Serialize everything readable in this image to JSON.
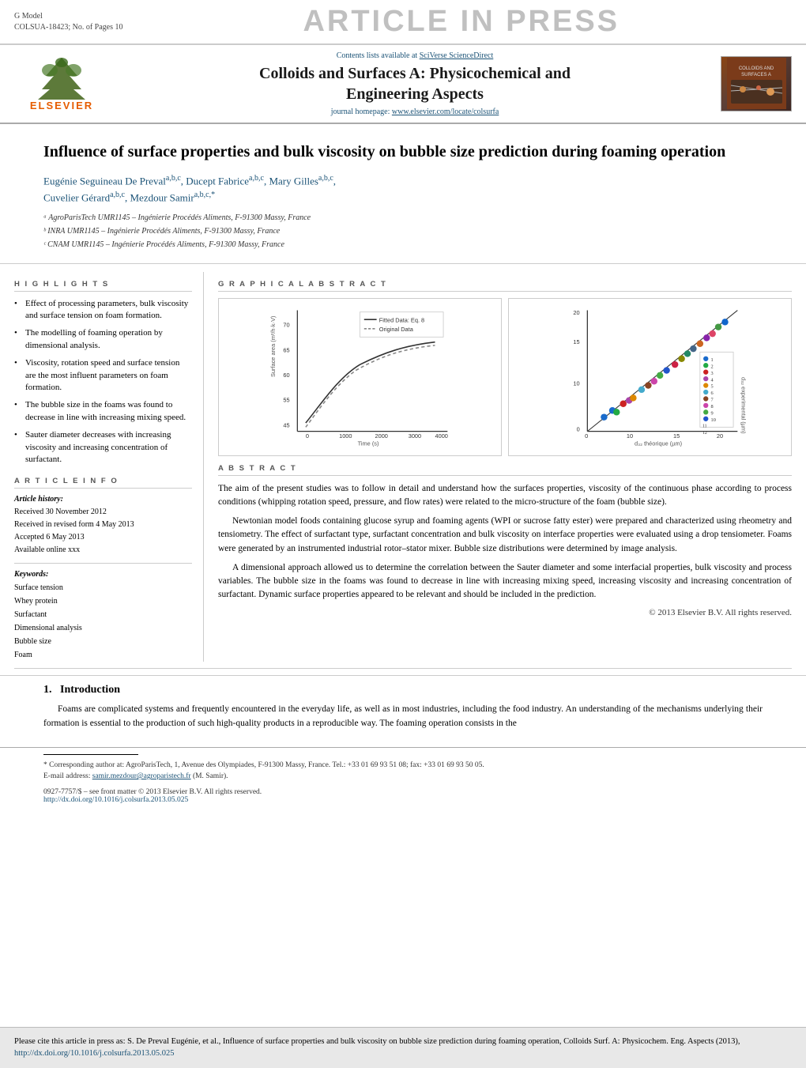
{
  "top_header": {
    "g_model": "G Model",
    "colsua": "COLSUA-18423;   No. of Pages 10",
    "banner": "ARTICLE IN PRESS"
  },
  "journal": {
    "sciverse_text": "Contents lists available at SciVerse ScienceDirect",
    "title_line1": "Colloids and Surfaces A: Physicochemical and",
    "title_line2": "Engineering Aspects",
    "homepage_label": "journal homepage:",
    "homepage_url": "www.elsevier.com/locate/colsurfa",
    "elsevier_label": "ELSEVIER"
  },
  "article": {
    "title": "Influence of surface properties and bulk viscosity on bubble size prediction during foaming operation",
    "authors": "Eugénie Seguineau De Prevalᵃᵇᶜ, Ducept Fabriceᵃᵇᶜ, Mary Gillesᵃᵇᶜ, Cuvelier Gérardᵃᵇᶜ, Mezdour Samirᵃᵇᶜ*",
    "affil_a": "ᵃ AgroParisTech UMR1145 – Ingénierie Procédés Aliments, F-91300 Massy, France",
    "affil_b": "ᵇ INRA UMR1145 – Ingénierie Procédés Aliments, F-91300 Massy, France",
    "affil_c": "ᶜ CNAM UMR1145 – Ingénierie Procédés Aliments, F-91300 Massy, France"
  },
  "highlights": {
    "header": "H I G H L I G H T S",
    "items": [
      "Effect of processing parameters, bulk viscosity and surface tension on foam formation.",
      "The modelling of foaming operation by dimensional analysis.",
      "Viscosity, rotation speed and surface tension are the most influent parameters on foam formation.",
      "The bubble size in the foams was found to decrease in line with increasing mixing speed.",
      "Sauter diameter decreases with increasing viscosity and increasing concentration of surfactant."
    ]
  },
  "article_info": {
    "header": "A R T I C L E   I N F O",
    "history_label": "Article history:",
    "received": "Received 30 November 2012",
    "revised": "Received in revised form 4 May 2013",
    "accepted": "Accepted 6 May 2013",
    "available": "Available online xxx",
    "keywords_label": "Keywords:",
    "keywords": [
      "Surface tension",
      "Whey protein",
      "Surfactant",
      "Dimensional analysis",
      "Bubble size",
      "Foam"
    ]
  },
  "graphical_abstract": {
    "header": "G R A P H I C A L   A B S T R A C T",
    "legend_fitted": "Fitted Data: Eq. 8",
    "legend_original": "Original Data",
    "left_axis": "Surface area (m²/h·k·V)",
    "bottom_axis": "Time (s)",
    "right_axis_top": "20",
    "right_axis_bottom": "0",
    "right_bottom_axis": "d32 théorique (µm)"
  },
  "abstract": {
    "header": "A B S T R A C T",
    "para1": "The aim of the present studies was to follow in detail and understand how the surfaces properties, viscosity of the continuous phase according to process conditions (whipping rotation speed, pressure, and flow rates) were related to the micro-structure of the foam (bubble size).",
    "para2": "Newtonian model foods containing glucose syrup and foaming agents (WPI or sucrose fatty ester) were prepared and characterized using rheometry and tensiometry. The effect of surfactant type, surfactant concentration and bulk viscosity on interface properties were evaluated using a drop tensiometer. Foams were generated by an instrumented industrial rotor–stator mixer. Bubble size distributions were determined by image analysis.",
    "para3": "A dimensional approach allowed us to determine the correlation between the Sauter diameter and some interfacial properties, bulk viscosity and process variables. The bubble size in the foams was found to decrease in line with increasing mixing speed, increasing viscosity and increasing concentration of surfactant. Dynamic surface properties appeared to be relevant and should be included in the prediction.",
    "copyright": "© 2013 Elsevier B.V. All rights reserved."
  },
  "introduction": {
    "section_number": "1.",
    "section_title": "Introduction",
    "para1": "Foams are complicated systems and frequently encountered in the everyday life, as well as in most industries, including the food industry. An understanding of the mechanisms underlying their formation is essential to the production of such high-quality products in a reproducible way. The foaming operation consists in the"
  },
  "footnote": {
    "star_text": "* Corresponding author at: AgroParisTech, 1, Avenue des Olympiades, F-91300 Massy, France. Tel.: +33 01 69 93 51 08; fax: +33 01 69 93 50 05.",
    "email_label": "E-mail address:",
    "email": "samir.mezdour@agroparistech.fr",
    "email_name": "(M. Samir).",
    "issn": "0927-7757/$ – see front matter © 2013 Elsevier B.V. All rights reserved.",
    "doi": "http://dx.doi.org/10.1016/j.colsurfa.2013.05.025"
  },
  "cite_box": {
    "text": "Please cite this article in press as: S. De Preval Eugénie, et al., Influence of surface properties and bulk viscosity on bubble size prediction during foaming operation, Colloids Surf. A: Physicochem. Eng. Aspects (2013),",
    "link": "http://dx.doi.org/10.1016/j.colsurfa.2013.05.025"
  }
}
